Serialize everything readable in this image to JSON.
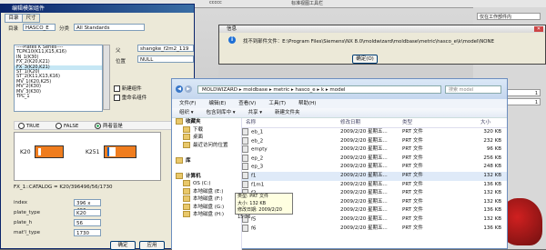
{
  "nx": {
    "strip": [
      "ccccc",
      "标准视图工具栏"
    ],
    "right_cells": [
      "仅在工作部件内",
      "1",
      "1"
    ]
  },
  "left_dialog": {
    "title": "编辑模架组件",
    "tabs": [
      "目录",
      "尺寸"
    ],
    "catalog_label": "目录",
    "catalog_value": "HASCO_E",
    "category_label": "分类",
    "category_value": "All Standards",
    "list_items": [
      "----Plates K Series----",
      "TCPK10(K11,K15,K16)",
      "IN_1(K30)",
      "FX_2(K20,K21)",
      "FX_3(K20,K21)",
      "ST_1(K20)",
      "ST_2(K11,K13,K16)",
      "MV_1(K20,K25)",
      "MV_2(K30)",
      "MV_3(K30)",
      "TPL_1"
    ],
    "selected_index": 4,
    "parent_label": "父",
    "parent_value": "shangke_f2m2_119",
    "position_label": "位置",
    "position_value": "NULL",
    "check_new": "新建组件",
    "check_rename": "重命名组件",
    "radios": [
      "TRUE",
      "FALSE",
      "两者皆是"
    ],
    "radio_selected": 2,
    "preview_a": "K20",
    "preview_b": "K251",
    "catalog_line": "FX_1::CATALOG = K20/396496/56/1730",
    "params": [
      {
        "label": "index",
        "value": "396 x 496"
      },
      {
        "label": "plate_type",
        "value": "K20"
      },
      {
        "label": "plate_h",
        "value": "56"
      },
      {
        "label": "mat'l_type",
        "value": "1730"
      }
    ],
    "ok": "确定",
    "apply": "应用"
  },
  "info_dialog": {
    "title": "信息",
    "message": "找不到部件文件：E:\\Program Files\\Siemens\\NX 8.0\\moldwizard\\moldbase\\metric\\hasco_e\\k\\model\\NONE",
    "ok": "确定(O)"
  },
  "explorer": {
    "path": [
      "MOLDWIZARD",
      "moldbase",
      "metric",
      "hasco_e",
      "k",
      "model"
    ],
    "search_placeholder": "搜索 model",
    "menu": [
      "文件(F)",
      "编辑(E)",
      "查看(V)",
      "工具(T)",
      "帮助(H)"
    ],
    "commands": [
      "组织 ▾",
      "包含到库中 ▾",
      "共享 ▾",
      "新建文件夹"
    ],
    "nav": [
      "收藏夹",
      "下载",
      "桌面",
      "最近访问的位置",
      "",
      "库",
      "",
      "计算机",
      "OS (C:)",
      "本地磁盘 (E:)",
      "本地磁盘 (F:)",
      "本地磁盘 (G:)",
      "本地磁盘 (H:)"
    ],
    "columns": [
      "名称",
      "修改日期",
      "类型",
      "大小"
    ],
    "files": [
      {
        "name": "eb_1",
        "date": "2009/2/20 星期五...",
        "type": "PRT 文件",
        "size": "320 KB"
      },
      {
        "name": "eb_2",
        "date": "2009/2/20 星期五...",
        "type": "PRT 文件",
        "size": "232 KB"
      },
      {
        "name": "empty",
        "date": "2009/2/20 星期五...",
        "type": "PRT 文件",
        "size": "96 KB"
      },
      {
        "name": "ep_2",
        "date": "2009/2/20 星期五...",
        "type": "PRT 文件",
        "size": "256 KB"
      },
      {
        "name": "ep_3",
        "date": "2009/2/20 星期五...",
        "type": "PRT 文件",
        "size": "248 KB"
      },
      {
        "name": "f1",
        "date": "2009/2/20 星期五...",
        "type": "PRT 文件",
        "size": "132 KB"
      },
      {
        "name": "f1m1",
        "date": "2009/2/20 星期五...",
        "type": "PRT 文件",
        "size": "136 KB"
      },
      {
        "name": "f2",
        "date": "2009/2/20 星期五...",
        "type": "PRT 文件",
        "size": "132 KB"
      },
      {
        "name": "f2m1",
        "date": "2009/2/20 星期五...",
        "type": "PRT 文件",
        "size": "132 KB"
      },
      {
        "name": "f2m2",
        "date": "2009/2/20 星期五...",
        "type": "PRT 文件",
        "size": "136 KB"
      },
      {
        "name": "f5",
        "date": "2009/2/20 星期五...",
        "type": "PRT 文件",
        "size": "132 KB"
      },
      {
        "name": "f6",
        "date": "2009/2/20 星期五...",
        "type": "PRT 文件",
        "size": "136 KB"
      }
    ],
    "tooltip": [
      "类型: PRT 文件",
      "大小: 132 KB",
      "修改日期: 2009/2/20 15:26"
    ]
  }
}
